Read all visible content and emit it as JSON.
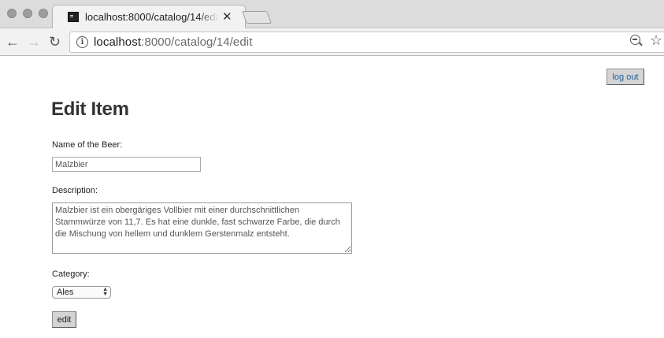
{
  "browser": {
    "tab_title": "localhost:8000/catalog/14/edit",
    "tab_close": "✕",
    "url_host": "localhost",
    "url_rest": ":8000/catalog/14/edit",
    "back": "←",
    "forward": "→",
    "reload": "↻",
    "info": "i",
    "star": "☆"
  },
  "header": {
    "logout_label": "log out"
  },
  "page": {
    "title": "Edit Item",
    "name_label": "Name of the Beer:",
    "name_value": "Malzbier",
    "description_label": "Description:",
    "description_value": "Malzbier ist ein obergäriges Vollbier mit einer durchschnittlichen Stammwürze von 11,7. Es hat eine dunkle, fast schwarze Farbe, die durch die Mischung von hellem und dunklem Gerstenmalz entsteht.",
    "category_label": "Category:",
    "category_selected": "Ales",
    "submit_label": "edit"
  },
  "colors": {
    "link_blue": "#1f5f96",
    "button_gray": "#d4d4d4",
    "title_text": "#333333"
  }
}
